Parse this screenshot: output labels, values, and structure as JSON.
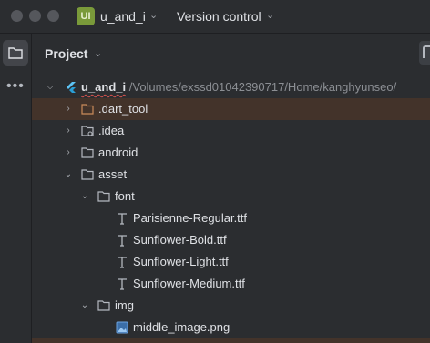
{
  "titlebar": {
    "project_badge": "UI",
    "project_name": "u_and_i",
    "version_control": "Version control"
  },
  "panel": {
    "title": "Project"
  },
  "tree": {
    "root": {
      "label": "u_and_i",
      "path": "/Volumes/exssd01042390717/Home/kanghyunseo/",
      "icon": "flutter-icon"
    },
    "items": [
      {
        "label": ".dart_tool",
        "icon": "folder-icon",
        "expanded": false,
        "selected": true
      },
      {
        "label": ".idea",
        "icon": "settings-folder-icon",
        "expanded": false
      },
      {
        "label": "android",
        "icon": "folder-icon",
        "expanded": false
      },
      {
        "label": "asset",
        "icon": "folder-icon",
        "expanded": true
      },
      {
        "label": "font",
        "icon": "folder-icon",
        "expanded": true
      },
      {
        "label": "Parisienne-Regular.ttf",
        "icon": "font-file-icon"
      },
      {
        "label": "Sunflower-Bold.ttf",
        "icon": "font-file-icon"
      },
      {
        "label": "Sunflower-Light.ttf",
        "icon": "font-file-icon"
      },
      {
        "label": "Sunflower-Medium.ttf",
        "icon": "font-file-icon"
      },
      {
        "label": "img",
        "icon": "folder-icon",
        "expanded": true
      },
      {
        "label": "middle_image.png",
        "icon": "image-file-icon"
      }
    ]
  },
  "colors": {
    "background": "#2b2d30",
    "selection": "#43332a",
    "badge": "#7a9a3a",
    "excluded_folder": "#c98a5a"
  }
}
